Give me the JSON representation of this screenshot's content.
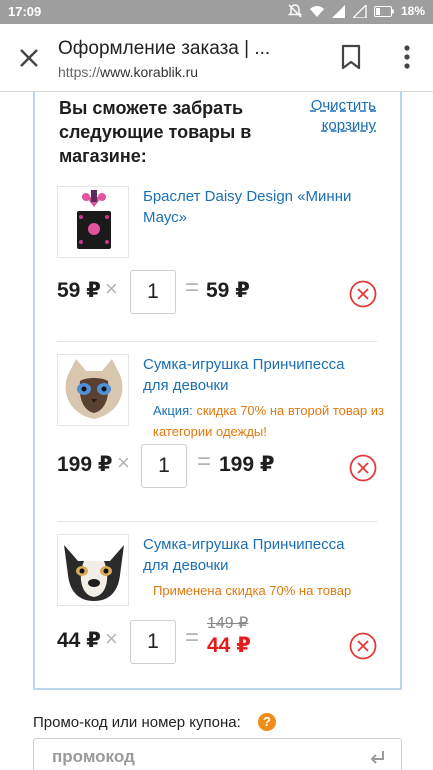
{
  "status_bar": {
    "time": "17:09",
    "battery": "18%"
  },
  "toolbar": {
    "page_title": "Оформление заказа | ...",
    "url_scheme": "https://",
    "url_host": "www.korablik.ru"
  },
  "cart": {
    "heading": "Вы сможете забрать следующие товары в магазине:",
    "clear_link": "Очистить корзину",
    "items": [
      {
        "name": "Браслет Daisy Design «Минни Маус»",
        "price": "59 ₽",
        "quantity": "1",
        "total": "59 ₽"
      },
      {
        "name": "Сумка-игрушка Принчипесса для девочки",
        "promo_label": "Акция:",
        "promo_text": "скидка 70% на второй товар из категории одежды!",
        "price": "199 ₽",
        "quantity": "1",
        "total": "199 ₽"
      },
      {
        "name": "Сумка-игрушка Принчипесса для девочки",
        "promo_text": "Применена скидка 70% на товар",
        "price": "44 ₽",
        "quantity": "1",
        "old_total": "149 ₽",
        "total": "44 ₽"
      }
    ]
  },
  "promo": {
    "label": "Промо-код или номер купона:",
    "help": "?",
    "placeholder": "промокод"
  },
  "colors": {
    "link": "#1b6fb5",
    "promo": "#e07a10",
    "discount_price": "#e41b1b",
    "remove": "#e33b3b",
    "cart_border": "#b9d4ec",
    "help_badge": "#f08c1a"
  }
}
